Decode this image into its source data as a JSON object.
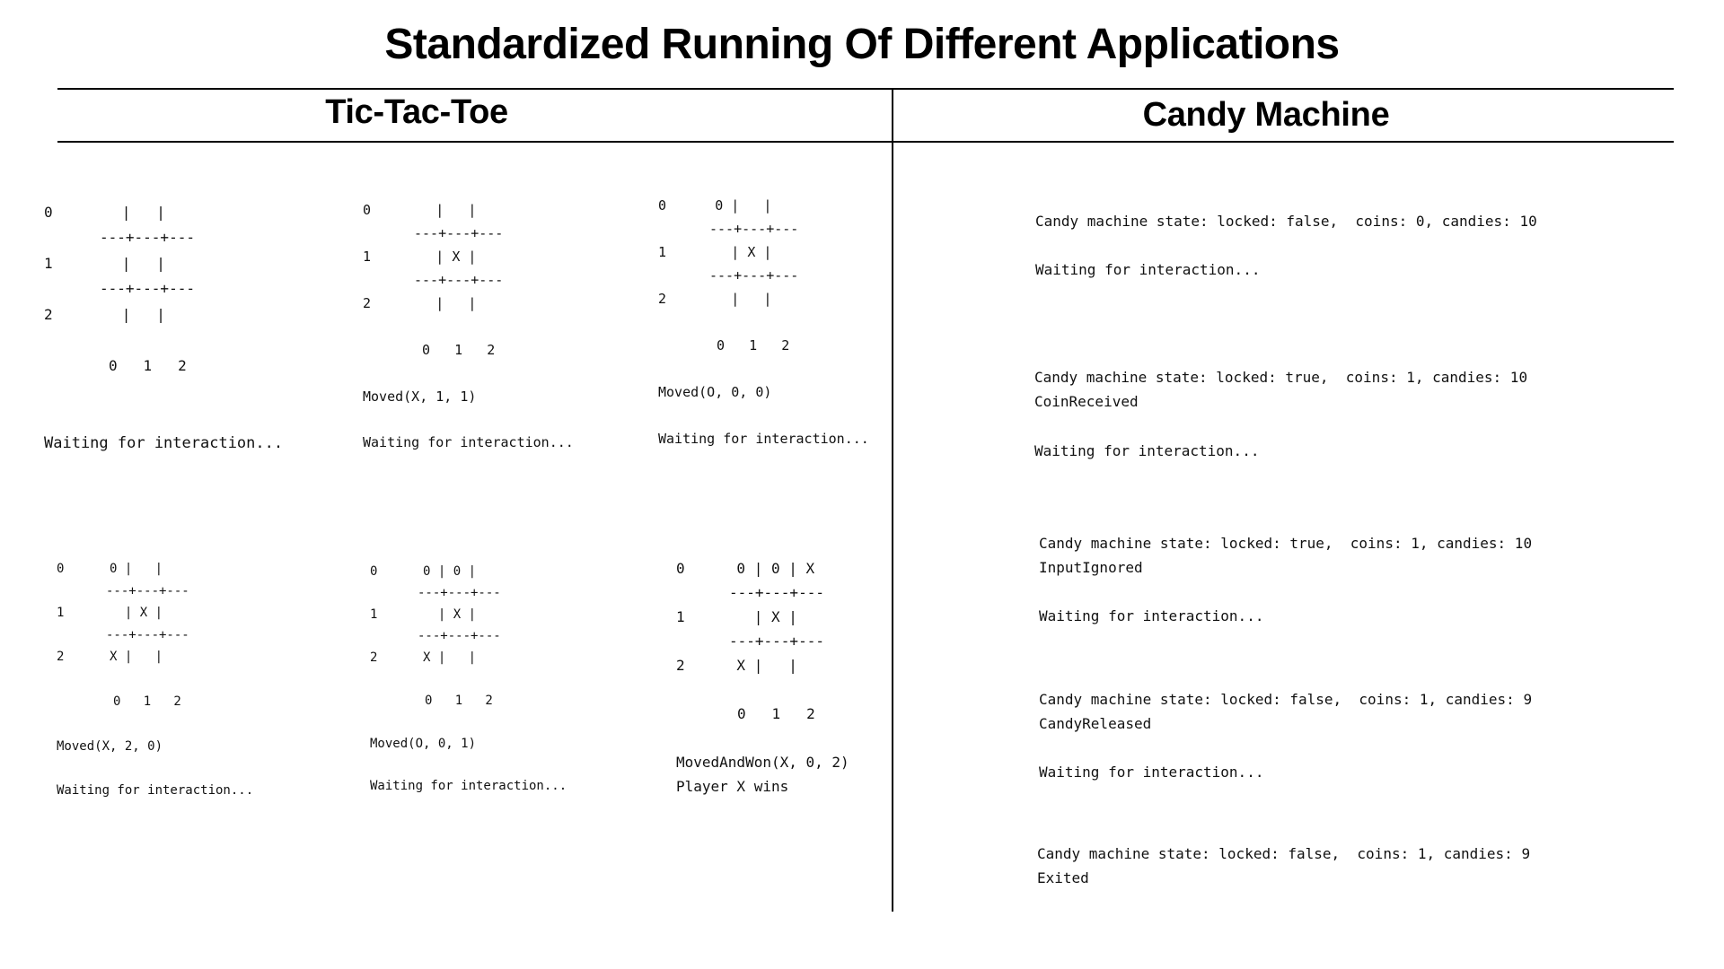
{
  "title": "Standardized Running Of Different Applications",
  "sections": {
    "tictactoe_header": "Tic-Tac-Toe",
    "candy_header": "Candy Machine"
  },
  "tictactoe": {
    "panels": [
      {
        "rows": [
          "0        |   |",
          "1        |   |",
          "2        |   |"
        ],
        "separator": "---+---+---",
        "cols": "0   1   2",
        "event": "",
        "result": "",
        "status": "Waiting for interaction..."
      },
      {
        "rows": [
          "0        |   |",
          "1        | X |",
          "2        |   |"
        ],
        "separator": "---+---+---",
        "cols": "0   1   2",
        "event": "Moved(X, 1, 1)",
        "result": "",
        "status": "Waiting for interaction..."
      },
      {
        "rows": [
          "0      0 |   |",
          "1        | X |",
          "2        |   |"
        ],
        "separator": "---+---+---",
        "cols": "0   1   2",
        "event": "Moved(O, 0, 0)",
        "result": "",
        "status": "Waiting for interaction..."
      },
      {
        "rows": [
          "0      0 |   |",
          "1        | X |",
          "2      X |   |"
        ],
        "separator": "---+---+---",
        "cols": "0   1   2",
        "event": "Moved(X, 2, 0)",
        "result": "",
        "status": "Waiting for interaction..."
      },
      {
        "rows": [
          "0      0 | 0 |",
          "1        | X |",
          "2      X |   |"
        ],
        "separator": "---+---+---",
        "cols": "0   1   2",
        "event": "Moved(O, 0, 1)",
        "result": "",
        "status": "Waiting for interaction..."
      },
      {
        "rows": [
          "0      0 | 0 | X",
          "1        | X |",
          "2      X |   |"
        ],
        "separator": "---+---+---",
        "cols": "0   1   2",
        "event": "MovedAndWon(X, 0, 2)",
        "result": "Player X wins",
        "status": ""
      }
    ]
  },
  "candy": {
    "blocks": [
      {
        "state": "Candy machine state: locked: false,  coins: 0, candies: 10",
        "event": "",
        "status": "Waiting for interaction..."
      },
      {
        "state": "Candy machine state: locked: true,  coins: 1, candies: 10",
        "event": "CoinReceived",
        "status": "Waiting for interaction..."
      },
      {
        "state": "Candy machine state: locked: true,  coins: 1, candies: 10",
        "event": "InputIgnored",
        "status": "Waiting for interaction..."
      },
      {
        "state": "Candy machine state: locked: false,  coins: 1, candies: 9",
        "event": "CandyReleased",
        "status": "Waiting for interaction..."
      },
      {
        "state": "Candy machine state: locked: false,  coins: 1, candies: 9",
        "event": "Exited",
        "status": ""
      }
    ]
  }
}
